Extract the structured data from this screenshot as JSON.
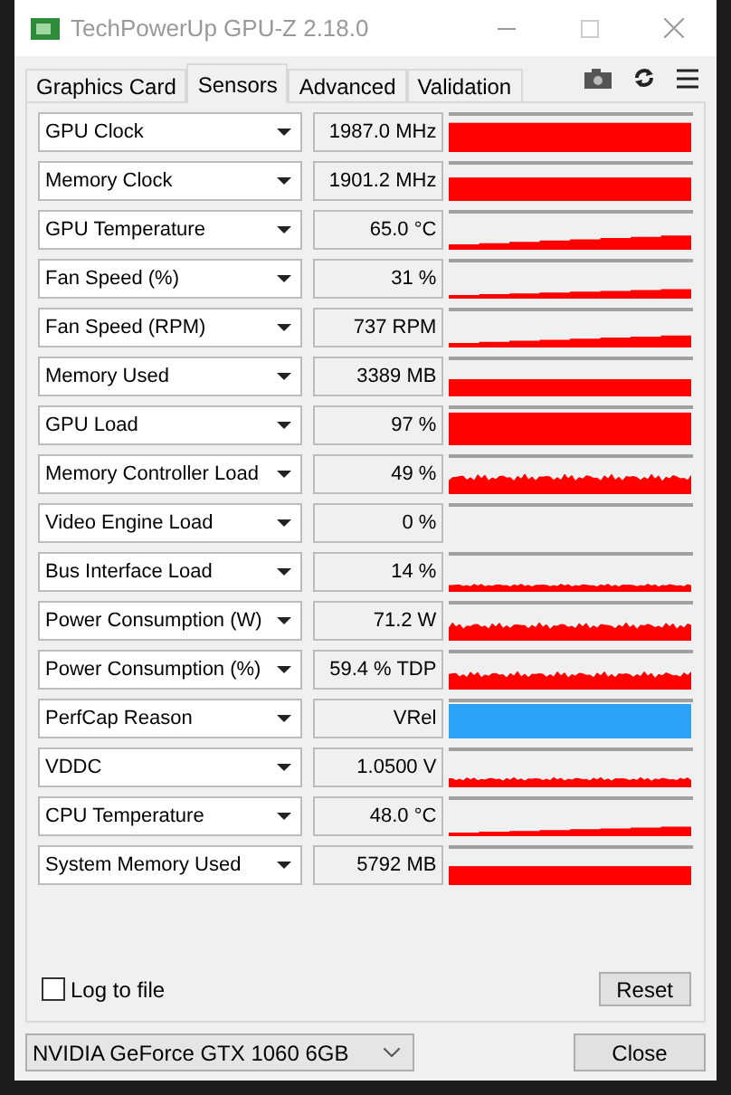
{
  "window": {
    "title": "TechPowerUp GPU-Z 2.18.0"
  },
  "tabs": [
    {
      "label": "Graphics Card",
      "selected": false
    },
    {
      "label": "Sensors",
      "selected": true
    },
    {
      "label": "Advanced",
      "selected": false
    },
    {
      "label": "Validation",
      "selected": false
    }
  ],
  "sensors": [
    {
      "name": "GPU Clock",
      "value": "1987.0 MHz",
      "color": "#ff0000"
    },
    {
      "name": "Memory Clock",
      "value": "1901.2 MHz",
      "color": "#ff0000"
    },
    {
      "name": "GPU Temperature",
      "value": "65.0 °C",
      "color": "#ff0000"
    },
    {
      "name": "Fan Speed (%)",
      "value": "31 %",
      "color": "#ff0000"
    },
    {
      "name": "Fan Speed (RPM)",
      "value": "737 RPM",
      "color": "#ff0000"
    },
    {
      "name": "Memory Used",
      "value": "3389 MB",
      "color": "#ff0000"
    },
    {
      "name": "GPU Load",
      "value": "97 %",
      "color": "#ff0000"
    },
    {
      "name": "Memory Controller Load",
      "value": "49 %",
      "color": "#ff0000"
    },
    {
      "name": "Video Engine Load",
      "value": "0 %"
    },
    {
      "name": "Bus Interface Load",
      "value": "14 %",
      "color": "#ff0000"
    },
    {
      "name": "Power Consumption (W)",
      "value": "71.2 W",
      "color": "#ff0000"
    },
    {
      "name": "Power Consumption (%)",
      "value": "59.4 % TDP",
      "color": "#ff0000"
    },
    {
      "name": "PerfCap Reason",
      "value": "VRel",
      "color": "#2aa2f5"
    },
    {
      "name": "VDDC",
      "value": "1.0500 V",
      "color": "#ff0000"
    },
    {
      "name": "CPU Temperature",
      "value": "48.0 °C",
      "color": "#ff0000"
    },
    {
      "name": "System Memory Used",
      "value": "5792 MB",
      "color": "#ff0000"
    }
  ],
  "log_to_file": {
    "label": "Log to file",
    "checked": false
  },
  "reset_button": "Reset",
  "gpu_select": {
    "value": "NVIDIA GeForce GTX 1060 6GB"
  },
  "close_button": "Close"
}
